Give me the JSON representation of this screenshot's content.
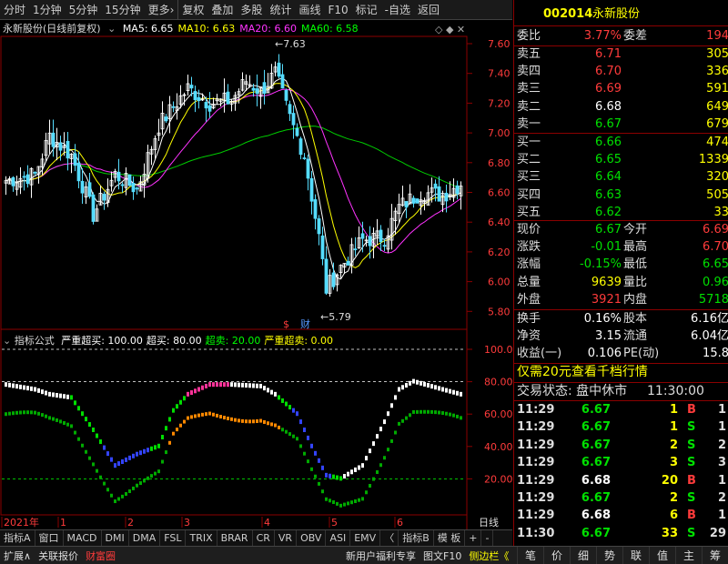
{
  "toolbar": {
    "items": [
      "分时",
      "1分钟",
      "5分钟",
      "15分钟",
      "更多",
      "复权",
      "叠加",
      "多股",
      "统计",
      "画线",
      "F10",
      "标记",
      "-自选",
      "返回"
    ]
  },
  "chart": {
    "stock_title": "永新股份(日线前复权)",
    "ma_labels": [
      {
        "text": "MA5: 6.65",
        "color": "#ffffff"
      },
      {
        "text": "MA10: 6.63",
        "color": "#ffff00"
      },
      {
        "text": "MA20: 6.60",
        "color": "#ff33ff"
      },
      {
        "text": "MA60: 6.58",
        "color": "#00ff00"
      }
    ],
    "price_axis": [
      "7.60",
      "7.40",
      "7.20",
      "7.00",
      "6.80",
      "6.60",
      "6.40",
      "6.20",
      "6.00",
      "5.80"
    ],
    "high_marker": "7.63",
    "low_marker": "5.79",
    "event_markers": [
      "$",
      "财"
    ],
    "indicator_title": "指标公式",
    "indicator_params": [
      {
        "text": "严重超买: 100.00",
        "color": "#ffffff"
      },
      {
        "text": "超买: 80.00",
        "color": "#ffffff"
      },
      {
        "text": "超卖: 20.00",
        "color": "#00ff00"
      },
      {
        "text": "严重超卖: 0.00",
        "color": "#ffff00"
      }
    ],
    "indicator_axis": [
      "100.0",
      "80.00",
      "60.00",
      "40.00",
      "20.00"
    ],
    "time_axis": [
      "2021年",
      "1",
      "2",
      "3",
      "4",
      "5",
      "6"
    ],
    "period_label": "日线"
  },
  "tabs": [
    "指标A",
    "窗口",
    "MACD",
    "DMI",
    "DMA",
    "FSL",
    "TRIX",
    "BRAR",
    "CR",
    "VR",
    "OBV",
    "ASI",
    "EMV",
    "〈",
    "指标B",
    "模 板",
    "+",
    "-"
  ],
  "statusbar": {
    "left": [
      "扩展∧",
      "关联报价",
      "财富圈"
    ],
    "middle": [
      "新用户福利专享",
      "图文F10",
      "侧边栏《"
    ],
    "icons": [
      "笔",
      "价",
      "细",
      "势",
      "联",
      "值",
      "主",
      "筹"
    ]
  },
  "quote": {
    "code": "002014",
    "name": "永新股份",
    "weibi_label": "委比",
    "weibi": "3.77%",
    "weicha_label": "委差",
    "weicha": "194",
    "asks": [
      {
        "label": "卖五",
        "price": "6.71",
        "vol": "305",
        "color": "#ff3b3b"
      },
      {
        "label": "卖四",
        "price": "6.70",
        "vol": "336",
        "color": "#ff3b3b"
      },
      {
        "label": "卖三",
        "price": "6.69",
        "vol": "591",
        "color": "#ff3b3b"
      },
      {
        "label": "卖二",
        "price": "6.68",
        "vol": "649",
        "color": "#ffffff"
      },
      {
        "label": "卖一",
        "price": "6.67",
        "vol": "679",
        "color": "#00e000"
      }
    ],
    "bids": [
      {
        "label": "买一",
        "price": "6.66",
        "vol": "474",
        "color": "#00e000"
      },
      {
        "label": "买二",
        "price": "6.65",
        "vol": "1339",
        "color": "#00e000"
      },
      {
        "label": "买三",
        "price": "6.64",
        "vol": "320",
        "color": "#00e000"
      },
      {
        "label": "买四",
        "price": "6.63",
        "vol": "505",
        "color": "#00e000"
      },
      {
        "label": "买五",
        "price": "6.62",
        "vol": "33",
        "color": "#00e000"
      }
    ],
    "stats": [
      {
        "l1": "现价",
        "v1": "6.67",
        "c1": "#00e000",
        "l2": "今开",
        "v2": "6.69",
        "c2": "#ff3b3b"
      },
      {
        "l1": "涨跌",
        "v1": "-0.01",
        "c1": "#00e000",
        "l2": "最高",
        "v2": "6.70",
        "c2": "#ff3b3b"
      },
      {
        "l1": "涨幅",
        "v1": "-0.15%",
        "c1": "#00e000",
        "l2": "最低",
        "v2": "6.65",
        "c2": "#00e000"
      },
      {
        "l1": "总量",
        "v1": "9639",
        "c1": "#ffff00",
        "l2": "量比",
        "v2": "0.96",
        "c2": "#00e000"
      },
      {
        "l1": "外盘",
        "v1": "3921",
        "c1": "#ff3b3b",
        "l2": "内盘",
        "v2": "5718",
        "c2": "#00e000"
      }
    ],
    "fund": [
      {
        "l1": "换手",
        "v1": "0.16%",
        "l2": "股本",
        "v2": "6.16亿"
      },
      {
        "l1": "净资",
        "v1": "3.15",
        "l2": "流通",
        "v2": "6.04亿"
      },
      {
        "l1": "收益(一)",
        "v1": "0.106",
        "l2": "PE(动)",
        "v2": "15.8"
      }
    ],
    "promo": "仅需20元查看千档行情",
    "trade_status_label": "交易状态: 盘中休市",
    "trade_status_time": "11:30:00",
    "ticks": [
      {
        "time": "11:29",
        "price": "6.67",
        "pc": "#00e000",
        "vol": "1",
        "vc": "#ffff00",
        "bs": "B",
        "bc": "#ff3b3b",
        "n": "1"
      },
      {
        "time": "11:29",
        "price": "6.67",
        "pc": "#00e000",
        "vol": "1",
        "vc": "#ffff00",
        "bs": "S",
        "bc": "#00e000",
        "n": "1"
      },
      {
        "time": "11:29",
        "price": "6.67",
        "pc": "#00e000",
        "vol": "2",
        "vc": "#ffff00",
        "bs": "S",
        "bc": "#00e000",
        "n": "2"
      },
      {
        "time": "11:29",
        "price": "6.67",
        "pc": "#00e000",
        "vol": "3",
        "vc": "#ffff00",
        "bs": "S",
        "bc": "#00e000",
        "n": "3"
      },
      {
        "time": "11:29",
        "price": "6.68",
        "pc": "#ffffff",
        "vol": "20",
        "vc": "#ffff00",
        "bs": "B",
        "bc": "#ff3b3b",
        "n": "1"
      },
      {
        "time": "11:29",
        "price": "6.67",
        "pc": "#00e000",
        "vol": "2",
        "vc": "#ffff00",
        "bs": "S",
        "bc": "#00e000",
        "n": "2"
      },
      {
        "time": "11:29",
        "price": "6.68",
        "pc": "#ffffff",
        "vol": "6",
        "vc": "#ffff00",
        "bs": "B",
        "bc": "#ff3b3b",
        "n": "1"
      },
      {
        "time": "11:30",
        "price": "6.67",
        "pc": "#00e000",
        "vol": "33",
        "vc": "#ffff00",
        "bs": "S",
        "bc": "#00e000",
        "n": "29"
      }
    ]
  }
}
